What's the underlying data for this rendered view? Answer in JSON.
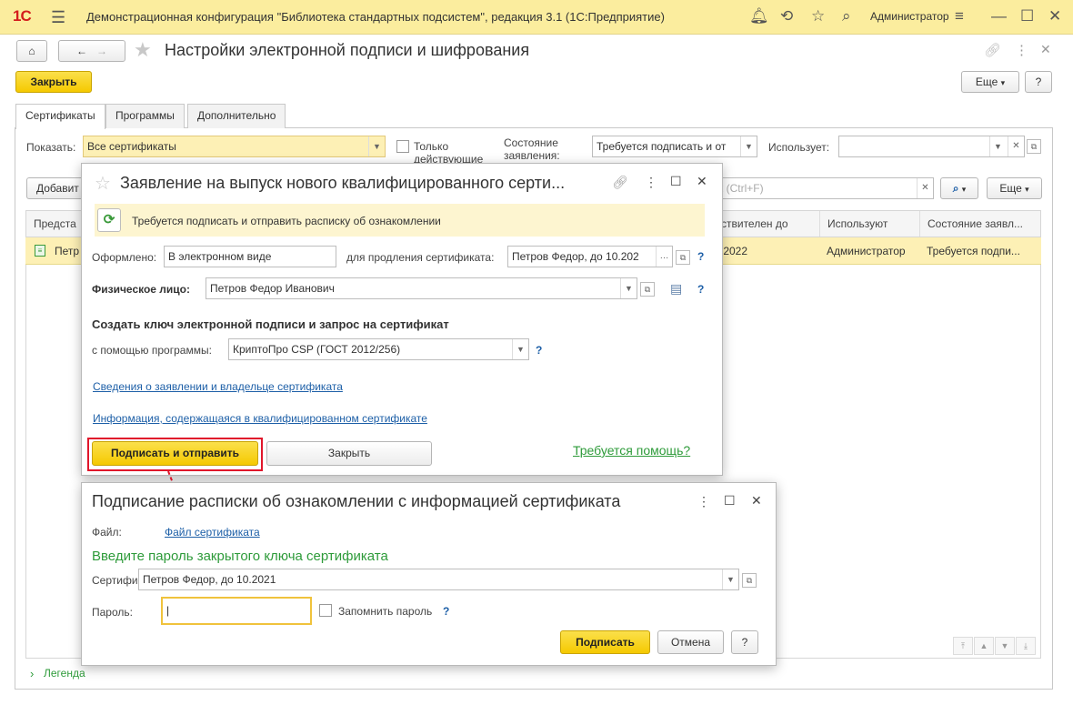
{
  "app": {
    "logo": "1С",
    "title": "Демонстрационная конфигурация \"Библиотека стандартных подсистем\", редакция 3.1  (1С:Предприятие)",
    "user": "Администратор"
  },
  "form": {
    "title": "Настройки электронной подписи и шифрования",
    "close_label": "Закрыть",
    "more_label": "Еще",
    "help_label": "?"
  },
  "tabs": [
    {
      "label": "Сертификаты",
      "active": true
    },
    {
      "label": "Программы",
      "active": false
    },
    {
      "label": "Дополнительно",
      "active": false
    }
  ],
  "filters": {
    "show_label": "Показать:",
    "show_value": "Все сертификаты",
    "only_valid_label": "Только действующие",
    "state_label": "Состояние заявления:",
    "state_value": "Требуется подписать и от",
    "uses_label": "Использует:",
    "uses_value": ""
  },
  "toolbar": {
    "add_label": "Добавит",
    "search_placeholder": "к (Ctrl+F)",
    "more_label": "Еще"
  },
  "grid": {
    "columns": [
      "Предста",
      "ствителен до",
      "Используют",
      "Состояние заявл..."
    ],
    "rows": [
      {
        "name": "Петр",
        "valid_to": ".2022",
        "users": "Администратор",
        "state": "Требуется подпи..."
      }
    ]
  },
  "legend_label": "Легенда",
  "dialog1": {
    "title": "Заявление на выпуск нового квалифицированного серти...",
    "banner": "Требуется подписать и отправить расписку об ознакомлении",
    "issued_label": "Оформлено:",
    "issued_value": "В электронном виде",
    "renew_label": "для продления сертификата:",
    "renew_value": "Петров Федор, до 10.202",
    "person_label": "Физическое лицо:",
    "person_value": "Петров Федор Иванович",
    "section_title": "Создать ключ электронной подписи и запрос на сертификат",
    "program_label": "с помощью программы:",
    "program_value": "КриптоПро CSP (ГОСТ 2012/256)",
    "link1": "Сведения о заявлении и владельце сертификата",
    "link2": "Информация, содержащаяся в квалифицированном сертификате",
    "sign_send_label": "Подписать и отправить",
    "close_label": "Закрыть",
    "help_link": "Требуется помощь?",
    "help_q": "?"
  },
  "dialog2": {
    "title": "Подписание расписки об ознакомлении с информацией сертификата",
    "file_label": "Файл:",
    "file_link": "Файл сертификата",
    "prompt": "Введите пароль закрытого ключа сертификата",
    "cert_label": "Сертификат:",
    "cert_value": "Петров Федор, до 10.2021",
    "password_label": "Пароль:",
    "password_value": "",
    "remember_label": "Запомнить пароль",
    "help_q": "?",
    "sign_label": "Подписать",
    "cancel_label": "Отмена",
    "help_label": "?"
  },
  "colors": {
    "accent_yellow": "#f5c900",
    "titlebar": "#fbed9e",
    "link_blue": "#1d5fa7",
    "green": "#2e9b3a",
    "highlight_red": "#e0162b"
  }
}
